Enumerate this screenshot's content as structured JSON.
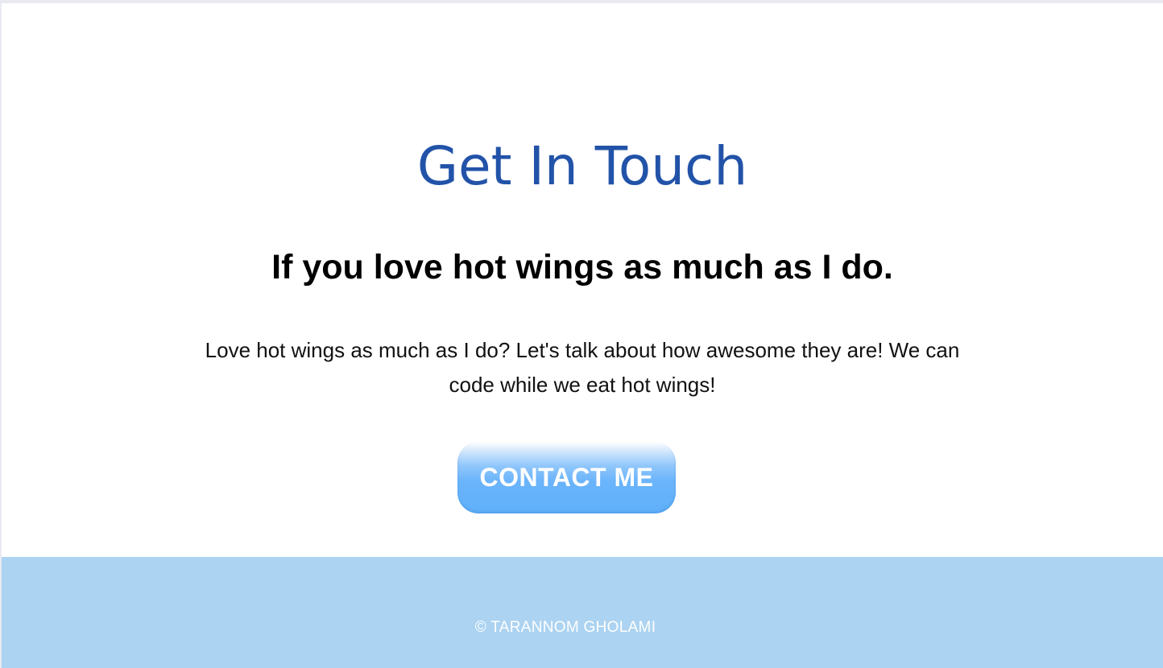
{
  "contact": {
    "heading": "Get In Touch",
    "subheading": "If you love hot wings as much as I do.",
    "body": "Love hot wings as much as I do? Let's talk about how awesome they are! We can code while we eat hot wings!",
    "button_label": "CONTACT ME"
  },
  "footer": {
    "copyright": "© TARANNOM GHOLAMI"
  },
  "colors": {
    "heading": "#2253a8",
    "button": "#5fb0fa",
    "footer_background": "#acd3f1"
  }
}
